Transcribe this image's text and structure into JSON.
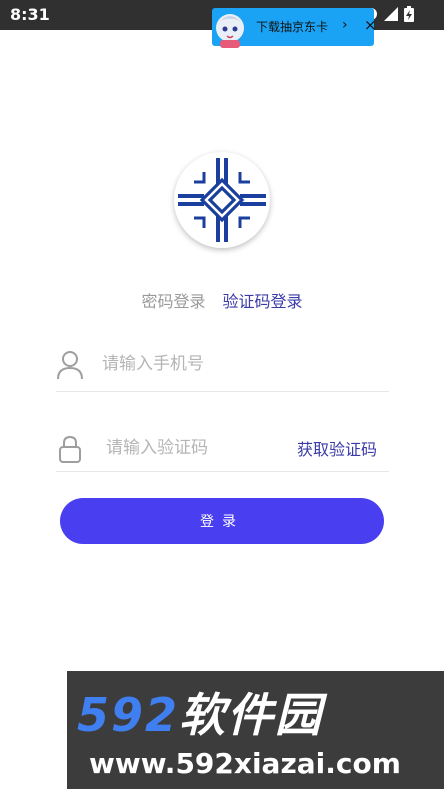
{
  "status_bar": {
    "time": "8:31"
  },
  "ad_banner": {
    "text": "下载抽京东卡",
    "arrow": "›",
    "close": "×"
  },
  "icons": {
    "logo": "company-logo",
    "user": "user-icon",
    "lock": "lock-icon",
    "wifi": "wifi-icon",
    "signal": "signal-icon",
    "battery": "battery-icon"
  },
  "tabs": {
    "password_login": "密码登录",
    "code_login": "验证码登录",
    "active": "code_login"
  },
  "phone_field": {
    "placeholder": "请输入手机号",
    "value": ""
  },
  "code_field": {
    "placeholder": "请输入验证码",
    "value": "",
    "get_code_label": "获取验证码"
  },
  "login_button": {
    "label": "登录"
  },
  "watermark": {
    "brand_num": "592",
    "brand_cn": "软件园",
    "url": "www.592xiazai.com"
  },
  "colors": {
    "accent": "#4a3ff0",
    "active_tab": "#3a3aa8",
    "inactive_tab": "#9a9a9a",
    "status_bar": "#303030",
    "ad_banner": "#1aa3f5",
    "logo_blue": "#1b3f9e"
  }
}
